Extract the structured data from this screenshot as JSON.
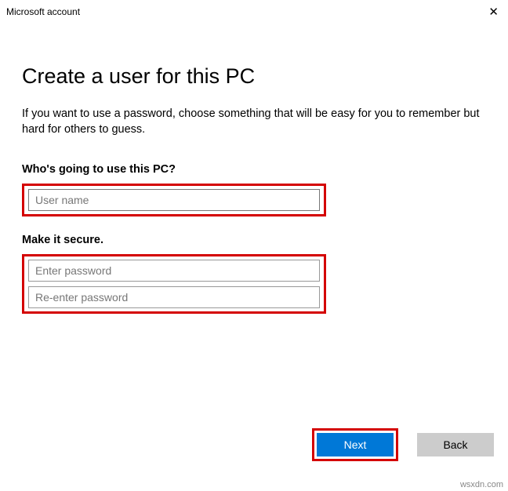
{
  "window": {
    "title": "Microsoft account"
  },
  "page": {
    "heading": "Create a user for this PC",
    "description": "If you want to use a password, choose something that will be easy for you to remember but hard for others to guess."
  },
  "section_user": {
    "label": "Who's going to use this PC?",
    "username_placeholder": "User name",
    "username_value": ""
  },
  "section_secure": {
    "label": "Make it secure.",
    "password_placeholder": "Enter password",
    "password_value": "",
    "confirm_placeholder": "Re-enter password",
    "confirm_value": ""
  },
  "buttons": {
    "next": "Next",
    "back": "Back"
  },
  "watermark": "wsxdn.com"
}
